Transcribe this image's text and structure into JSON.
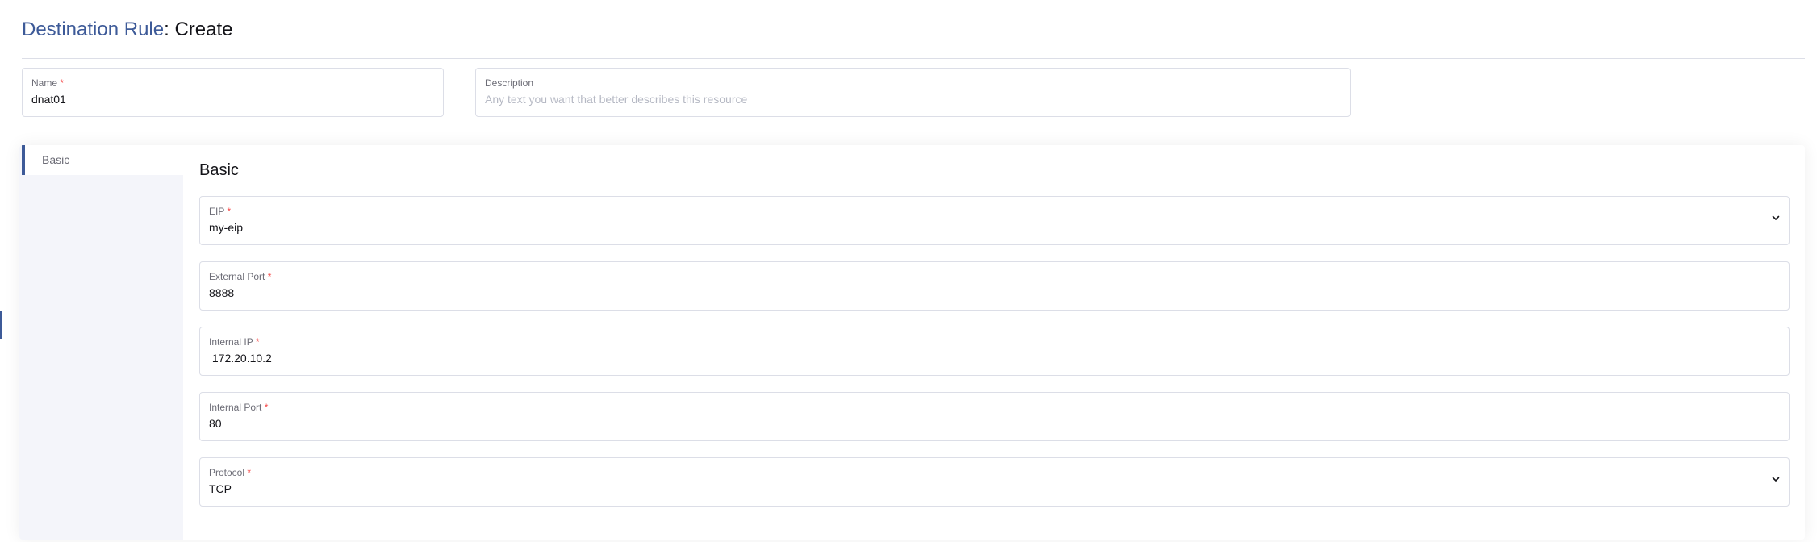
{
  "header": {
    "crumb": "Destination Rule",
    "separator": ":",
    "action": "Create"
  },
  "top_fields": {
    "name": {
      "label": "Name",
      "required_mark": "*",
      "value": "dnat01"
    },
    "description": {
      "label": "Description",
      "placeholder": "Any text you want that better describes this resource"
    }
  },
  "tabs": [
    {
      "label": "Basic",
      "active": true
    }
  ],
  "section": {
    "title": "Basic",
    "fields": [
      {
        "label": "EIP",
        "required_mark": "*",
        "value": "my-eip",
        "type": "select"
      },
      {
        "label": "External Port",
        "required_mark": "*",
        "value": "8888",
        "type": "input"
      },
      {
        "label": "Internal IP",
        "required_mark": "*",
        "value": " 172.20.10.2",
        "type": "input"
      },
      {
        "label": "Internal Port",
        "required_mark": "*",
        "value": "80",
        "type": "input"
      },
      {
        "label": "Protocol",
        "required_mark": "*",
        "value": "TCP",
        "type": "select"
      }
    ]
  },
  "colors": {
    "accent": "#3d5a98",
    "required": "#f64747",
    "border": "#dcdee7",
    "tab_background": "#f4f5fa"
  },
  "icons": {
    "select_caret": "chevron-down-icon"
  }
}
